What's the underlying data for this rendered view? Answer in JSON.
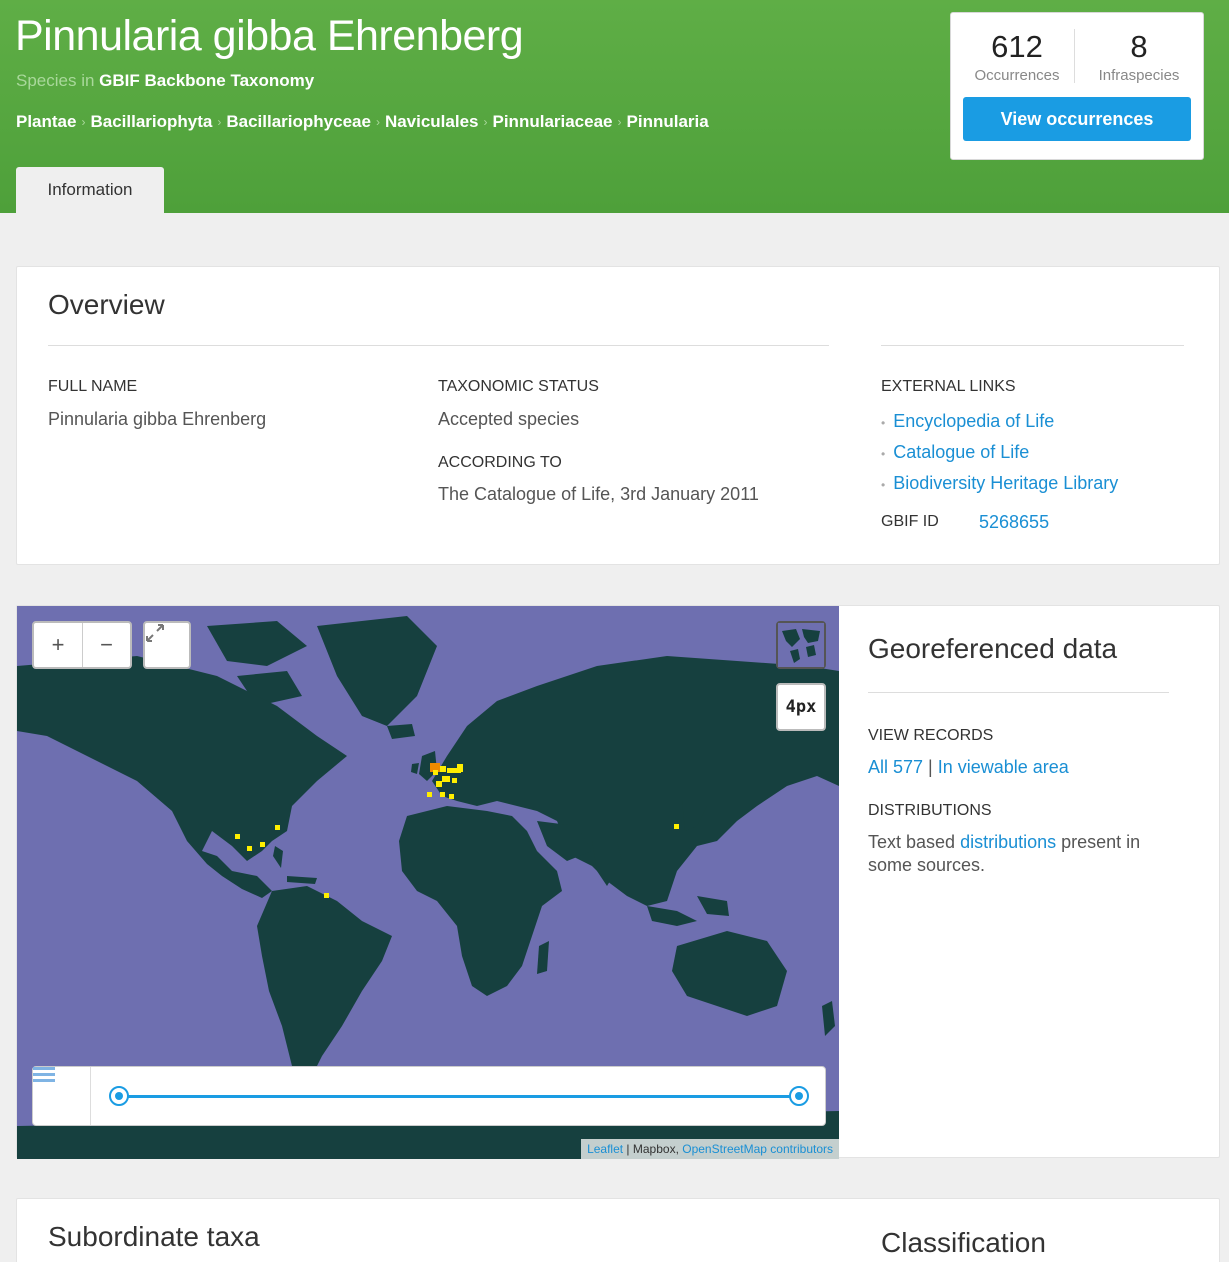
{
  "header": {
    "title": "Pinnularia gibba Ehrenberg",
    "subtitle_prefix": "Species in",
    "subtitle_link": "GBIF Backbone Taxonomy",
    "breadcrumbs": [
      "Plantae",
      "Bacillariophyta",
      "Bacillariophyceae",
      "Naviculales",
      "Pinnulariaceae",
      "Pinnularia"
    ],
    "tab": "Information"
  },
  "stats": {
    "occurrences_count": "612",
    "occurrences_label": "Occurrences",
    "infraspecies_count": "8",
    "infraspecies_label": "Infraspecies",
    "button": "View occurrences"
  },
  "overview": {
    "heading": "Overview",
    "full_name_label": "FULL NAME",
    "full_name": "Pinnularia gibba Ehrenberg",
    "status_label": "TAXONOMIC STATUS",
    "status": "Accepted species",
    "according_label": "ACCORDING TO",
    "according": "The Catalogue of Life, 3rd January 2011",
    "external_label": "EXTERNAL LINKS",
    "external_links": [
      "Encyclopedia of Life",
      "Catalogue of Life",
      "Biodiversity Heritage Library"
    ],
    "gbif_id_label": "GBIF ID",
    "gbif_id": "5268655"
  },
  "map": {
    "zoom_in": "+",
    "zoom_out": "−",
    "px_label": "4px",
    "attribution_leaflet": "Leaflet",
    "attribution_sep": " | Mapbox, ",
    "attribution_osm": "OpenStreetMap contributors",
    "ocean_color": "#6e6fb0",
    "land_color": "#16403f",
    "point_color": "#ffee00",
    "hot_point_color": "#f08a00"
  },
  "georef": {
    "heading": "Georeferenced data",
    "view_records_label": "VIEW RECORDS",
    "all_link": "All 577",
    "separator": " | ",
    "viewable_link": "In viewable area",
    "distributions_label": "DISTRIBUTIONS",
    "dist_text_pre": "Text based ",
    "dist_link": "distributions",
    "dist_text_post": " present in some sources."
  },
  "lower": {
    "subordinate": "Subordinate taxa",
    "classification": "Classification"
  }
}
